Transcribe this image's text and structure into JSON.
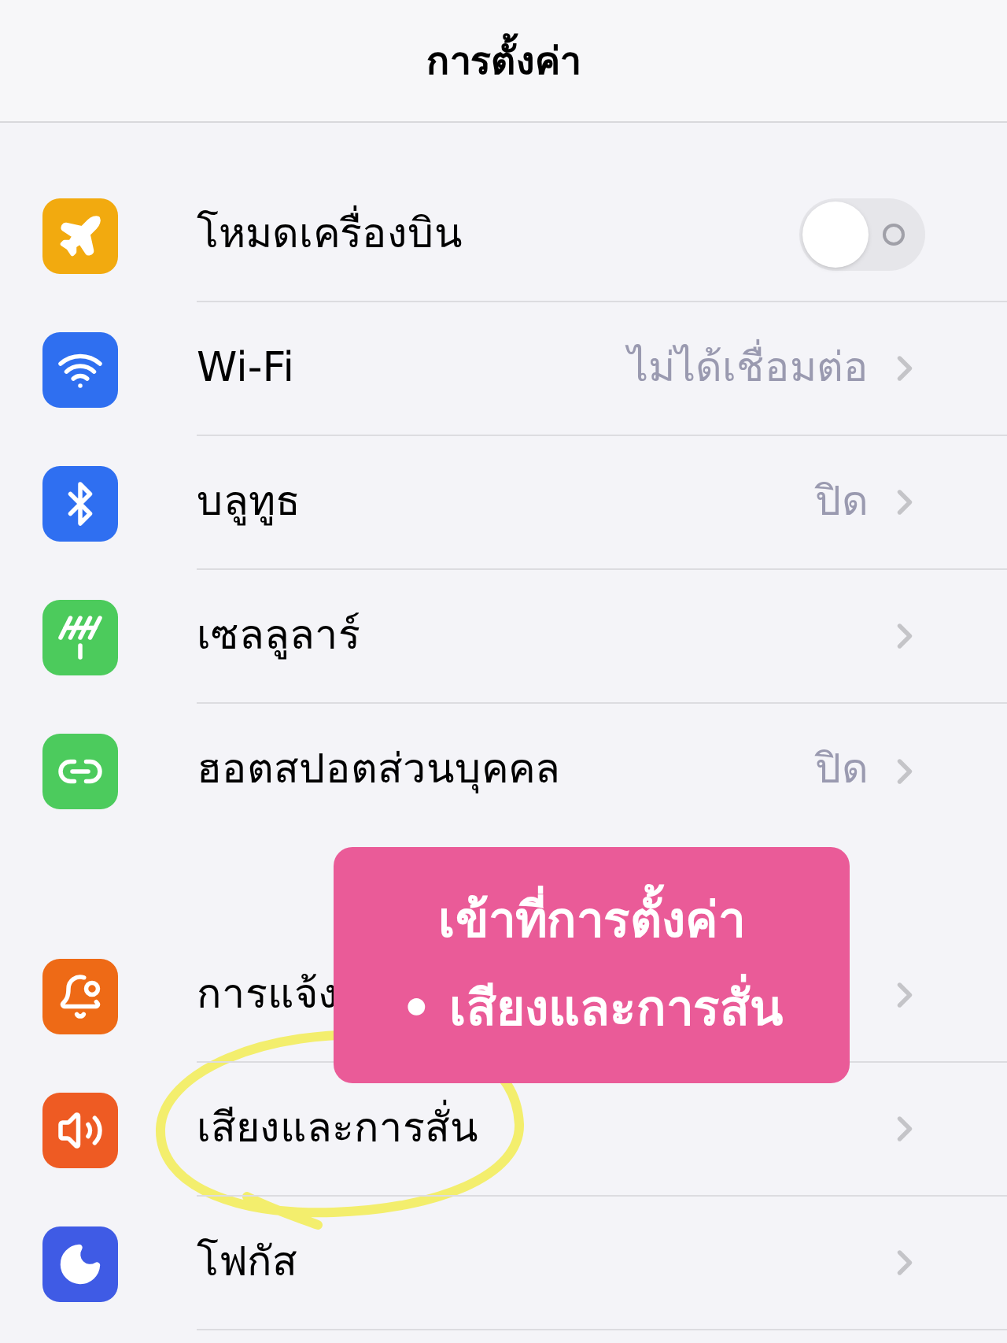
{
  "nav_title": "การตั้งค่า",
  "groups": [
    {
      "items": [
        {
          "color": "#f2aa0f",
          "label": "โหมดเครื่องบิน",
          "kind": "toggle",
          "on": false
        },
        {
          "color": "#2f6ff0",
          "label": "Wi-Fi",
          "kind": "link",
          "value": "ไม่ได้เชื่อมต่อ"
        },
        {
          "color": "#2f6ff1",
          "label": "บลูทูธ",
          "kind": "link",
          "value": "ปิด"
        },
        {
          "color": "#4ccb5c",
          "label": "เซลลูลาร์",
          "kind": "link"
        },
        {
          "color": "#4ccb5d",
          "label": "ฮอตสปอตส่วนบุคคล",
          "kind": "link",
          "value": "ปิด"
        }
      ]
    },
    {
      "items": [
        {
          "color": "#ee6a16",
          "label": "การแจ้ง",
          "kind": "link"
        },
        {
          "color": "#ee5b23",
          "label": "เสียงและการสั่น",
          "kind": "link"
        },
        {
          "color": "#3f5be5",
          "label": "โฟกัส",
          "kind": "link"
        }
      ]
    }
  ],
  "callout": {
    "lines": [
      "เข้าที่การตั้งค่า",
      "• เสียงและการสั่น"
    ]
  }
}
